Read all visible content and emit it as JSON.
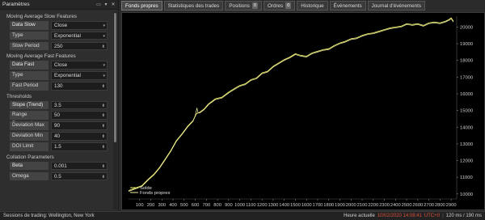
{
  "panel": {
    "title": "Paramètres"
  },
  "sections": [
    {
      "title": "Moving Average Slow Features",
      "rows": [
        {
          "label": "Data Slow",
          "value": "Close",
          "control": "dropdown"
        },
        {
          "label": "Type",
          "value": "Exponential",
          "control": "dropdown"
        },
        {
          "label": "Slow Period",
          "value": "250",
          "control": "stepper"
        }
      ]
    },
    {
      "title": "Moving Average Fast Features",
      "rows": [
        {
          "label": "Data Fast",
          "value": "Close",
          "control": "dropdown"
        },
        {
          "label": "Type",
          "value": "Exponential",
          "control": "dropdown"
        },
        {
          "label": "Fast Period",
          "value": "130",
          "control": "stepper"
        }
      ]
    },
    {
      "title": "Thresholds",
      "rows": [
        {
          "label": "Slope (Trend)",
          "value": "3.5",
          "control": "stepper"
        },
        {
          "label": "Range Removal",
          "value": "50",
          "control": "stepper"
        },
        {
          "label": "Deviation Max",
          "value": "90",
          "control": "stepper"
        },
        {
          "label": "Deviation Min",
          "value": "40",
          "control": "stepper"
        },
        {
          "label": "DOI Limit",
          "value": "1.5",
          "control": "stepper"
        }
      ]
    },
    {
      "title": "Collation Parameters",
      "rows": [
        {
          "label": "Beta",
          "value": "0.001",
          "control": "stepper"
        },
        {
          "label": "Omega",
          "value": "0.5",
          "control": "stepper"
        }
      ]
    }
  ],
  "tabs": [
    {
      "label": "Fonds propres",
      "active": true,
      "badge": ""
    },
    {
      "label": "Statistiques des trades",
      "active": false,
      "badge": ""
    },
    {
      "label": "Positions",
      "active": false,
      "badge": "0"
    },
    {
      "label": "Ordres",
      "active": false,
      "badge": "0"
    },
    {
      "label": "Historique",
      "active": false,
      "badge": ""
    },
    {
      "label": "Évènements",
      "active": false,
      "badge": ""
    },
    {
      "label": "Journal d'évènements",
      "active": false,
      "badge": ""
    }
  ],
  "chart_data": {
    "type": "line",
    "x_ticks": [
      "100",
      "200",
      "300",
      "400",
      "500",
      "600",
      "700",
      "800",
      "900",
      "1000",
      "1100",
      "1200",
      "1300",
      "1400",
      "1500",
      "1600",
      "1700",
      "1800",
      "1900",
      "2000",
      "2100",
      "2200",
      "2300",
      "2400",
      "2500",
      "2600",
      "2700",
      "2800",
      "2900"
    ],
    "y_ticks": [
      "10000",
      "11000",
      "12000",
      "13000",
      "14000",
      "15000",
      "16000",
      "17000",
      "18000",
      "19000",
      "20000"
    ],
    "xlim": [
      0,
      2950
    ],
    "ylim": [
      9700,
      20650
    ],
    "legend": [
      "Solde",
      "Fonds propres"
    ],
    "legend_position": "bottom-left",
    "grid": false,
    "line_color": "#e8e868",
    "series": [
      {
        "name": "Solde",
        "x": [
          0,
          60,
          120,
          180,
          230,
          280,
          330,
          380,
          430,
          480,
          530,
          580,
          610,
          640,
          680,
          720,
          780,
          840,
          900,
          960,
          1000,
          1050,
          1100,
          1150,
          1200,
          1250,
          1300,
          1350,
          1400,
          1450,
          1500,
          1550,
          1600,
          1650,
          1700,
          1750,
          1800,
          1850,
          1900,
          1950,
          2000,
          2050,
          2100,
          2150,
          2200,
          2250,
          2300,
          2350,
          2400,
          2450,
          2500,
          2550,
          2600,
          2650,
          2700,
          2750,
          2800,
          2850,
          2880,
          2900,
          2920
        ],
        "y": [
          10200,
          10350,
          10500,
          10900,
          11200,
          11600,
          12100,
          12600,
          13200,
          13600,
          14050,
          14400,
          14800,
          14900,
          15100,
          15400,
          15700,
          15800,
          16100,
          16350,
          16500,
          16600,
          16850,
          16950,
          17250,
          17350,
          17650,
          17850,
          18050,
          18200,
          18400,
          18300,
          18250,
          18450,
          18550,
          18650,
          18700,
          18900,
          19050,
          19150,
          19300,
          19350,
          19500,
          19600,
          19650,
          19750,
          19850,
          19950,
          20000,
          20050,
          20200,
          20150,
          20200,
          20100,
          20250,
          20300,
          20250,
          20350,
          20450,
          20550,
          20350
        ]
      },
      {
        "name": "Fonds propres",
        "x": [
          0,
          60,
          120,
          180,
          230,
          280,
          330,
          380,
          430,
          480,
          530,
          580,
          600,
          615,
          625,
          640,
          680,
          720,
          780,
          840,
          900,
          960,
          1000,
          1050,
          1100,
          1150,
          1200,
          1250,
          1300,
          1350,
          1400,
          1450,
          1500,
          1550,
          1600,
          1650,
          1700,
          1750,
          1800,
          1850,
          1900,
          1950,
          2000,
          2050,
          2100,
          2150,
          2200,
          2250,
          2300,
          2350,
          2400,
          2450,
          2500,
          2550,
          2600,
          2650,
          2700,
          2750,
          2800,
          2850,
          2880,
          2900,
          2920
        ],
        "y": [
          10150,
          10300,
          10450,
          10850,
          11150,
          11550,
          12050,
          12550,
          13150,
          13550,
          14000,
          14350,
          14700,
          15150,
          14850,
          14850,
          15050,
          15350,
          15650,
          15750,
          16050,
          16300,
          16450,
          16550,
          16800,
          16900,
          17200,
          17300,
          17600,
          17800,
          18000,
          18150,
          18350,
          18250,
          18200,
          18400,
          18500,
          18600,
          18650,
          18850,
          19000,
          19100,
          19250,
          19300,
          19450,
          19550,
          19600,
          19700,
          19800,
          19900,
          19950,
          20000,
          20150,
          20100,
          20150,
          20050,
          20200,
          20250,
          20200,
          20300,
          20400,
          20500,
          20300
        ]
      }
    ]
  },
  "status": {
    "left": "Sessions de trading: Wellington, New York",
    "server_time_label": "Heure actuelle",
    "server_time": "10/02/2020 14:08:41",
    "utc": "UTC+0",
    "latency": "120 ms / 190 ms"
  },
  "colors": {
    "accent_red": "#e0503a",
    "line": "#e8e868",
    "panel": "#2e2e2e",
    "chart_bg": "#000000"
  },
  "icons": {
    "panel_header": [
      "window-icon",
      "pin-icon",
      "close-icon"
    ]
  }
}
